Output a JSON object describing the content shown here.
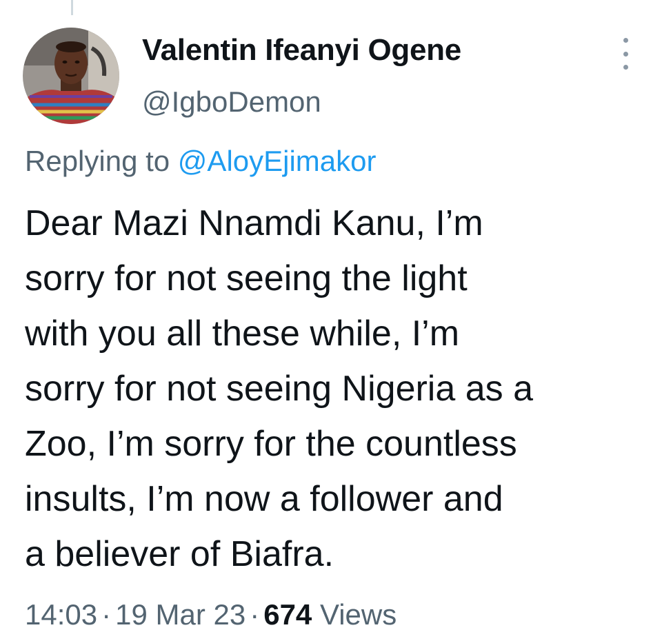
{
  "tweet": {
    "author": {
      "display_name": "Valentin Ifeanyi Ogene",
      "handle": "@IgboDemon"
    },
    "reply": {
      "prefix": "Replying to ",
      "mention": "@AloyEjimakor"
    },
    "text_lines": [
      "Dear Mazi Nnamdi Kanu, I’m",
      "sorry for not seeing the light",
      "with you all these while, I’m",
      "sorry for not seeing Nigeria as a",
      "Zoo, I’m sorry for the countless",
      "insults, I’m now a follower and",
      "a believer of Biafra."
    ],
    "meta": {
      "time": "14:03",
      "separator": "·",
      "date": "19 Mar 23",
      "views_count": "674",
      "views_label": "Views"
    }
  },
  "icons": {
    "more": "more-vertical-icon"
  },
  "colors": {
    "text_primary": "#0f1419",
    "text_secondary": "#536471",
    "link": "#1d9bf0"
  }
}
